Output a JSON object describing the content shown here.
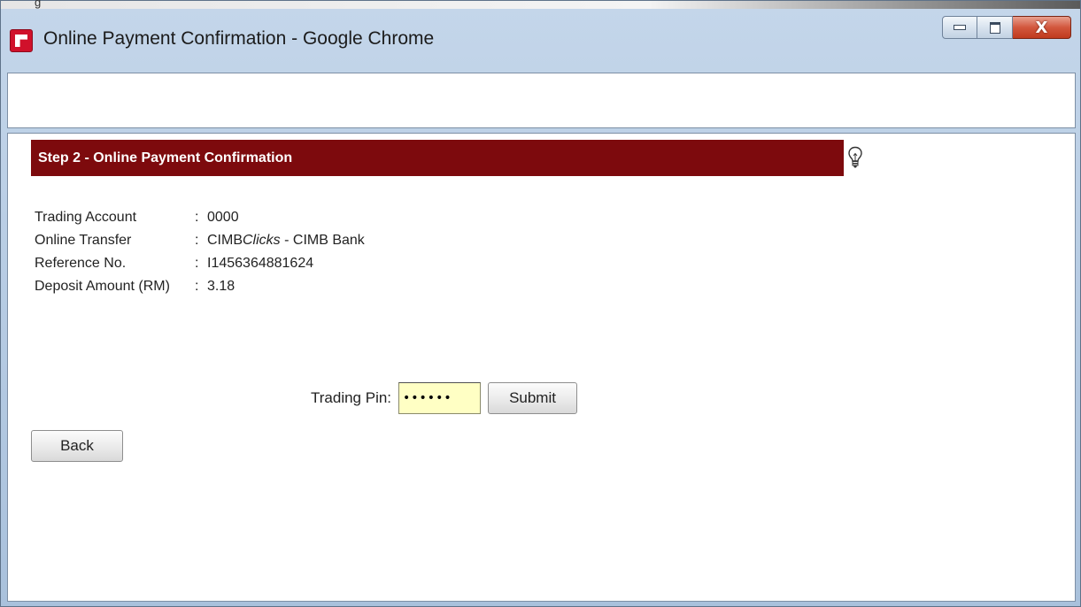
{
  "window": {
    "title": "Online Payment Confirmation - Google Chrome",
    "top_strip_text": "g",
    "controls": {
      "minimize": "minimize",
      "maximize": "maximize",
      "close": "X"
    }
  },
  "step": {
    "title": "Step 2 - Online Payment Confirmation",
    "hint_icon": "lightbulb-icon"
  },
  "details": {
    "rows": [
      {
        "label": "Trading Account",
        "sep": ":",
        "value": "0000"
      },
      {
        "label": "Online Transfer",
        "sep": ":",
        "value_prefix": "CIMB",
        "value_italic": "Clicks",
        "value_suffix": " - CIMB Bank"
      },
      {
        "label": "Reference No.",
        "sep": ":",
        "value": "I1456364881624"
      },
      {
        "label": "Deposit Amount (RM)",
        "sep": ":",
        "value": "3.18"
      }
    ]
  },
  "form": {
    "pin_label": "Trading Pin:",
    "pin_value": "••••••",
    "submit_label": "Submit",
    "back_label": "Back"
  },
  "colors": {
    "banner": "#7d0a0d",
    "pin_bg": "#ffffc4",
    "close_button": "#c03a1e"
  }
}
